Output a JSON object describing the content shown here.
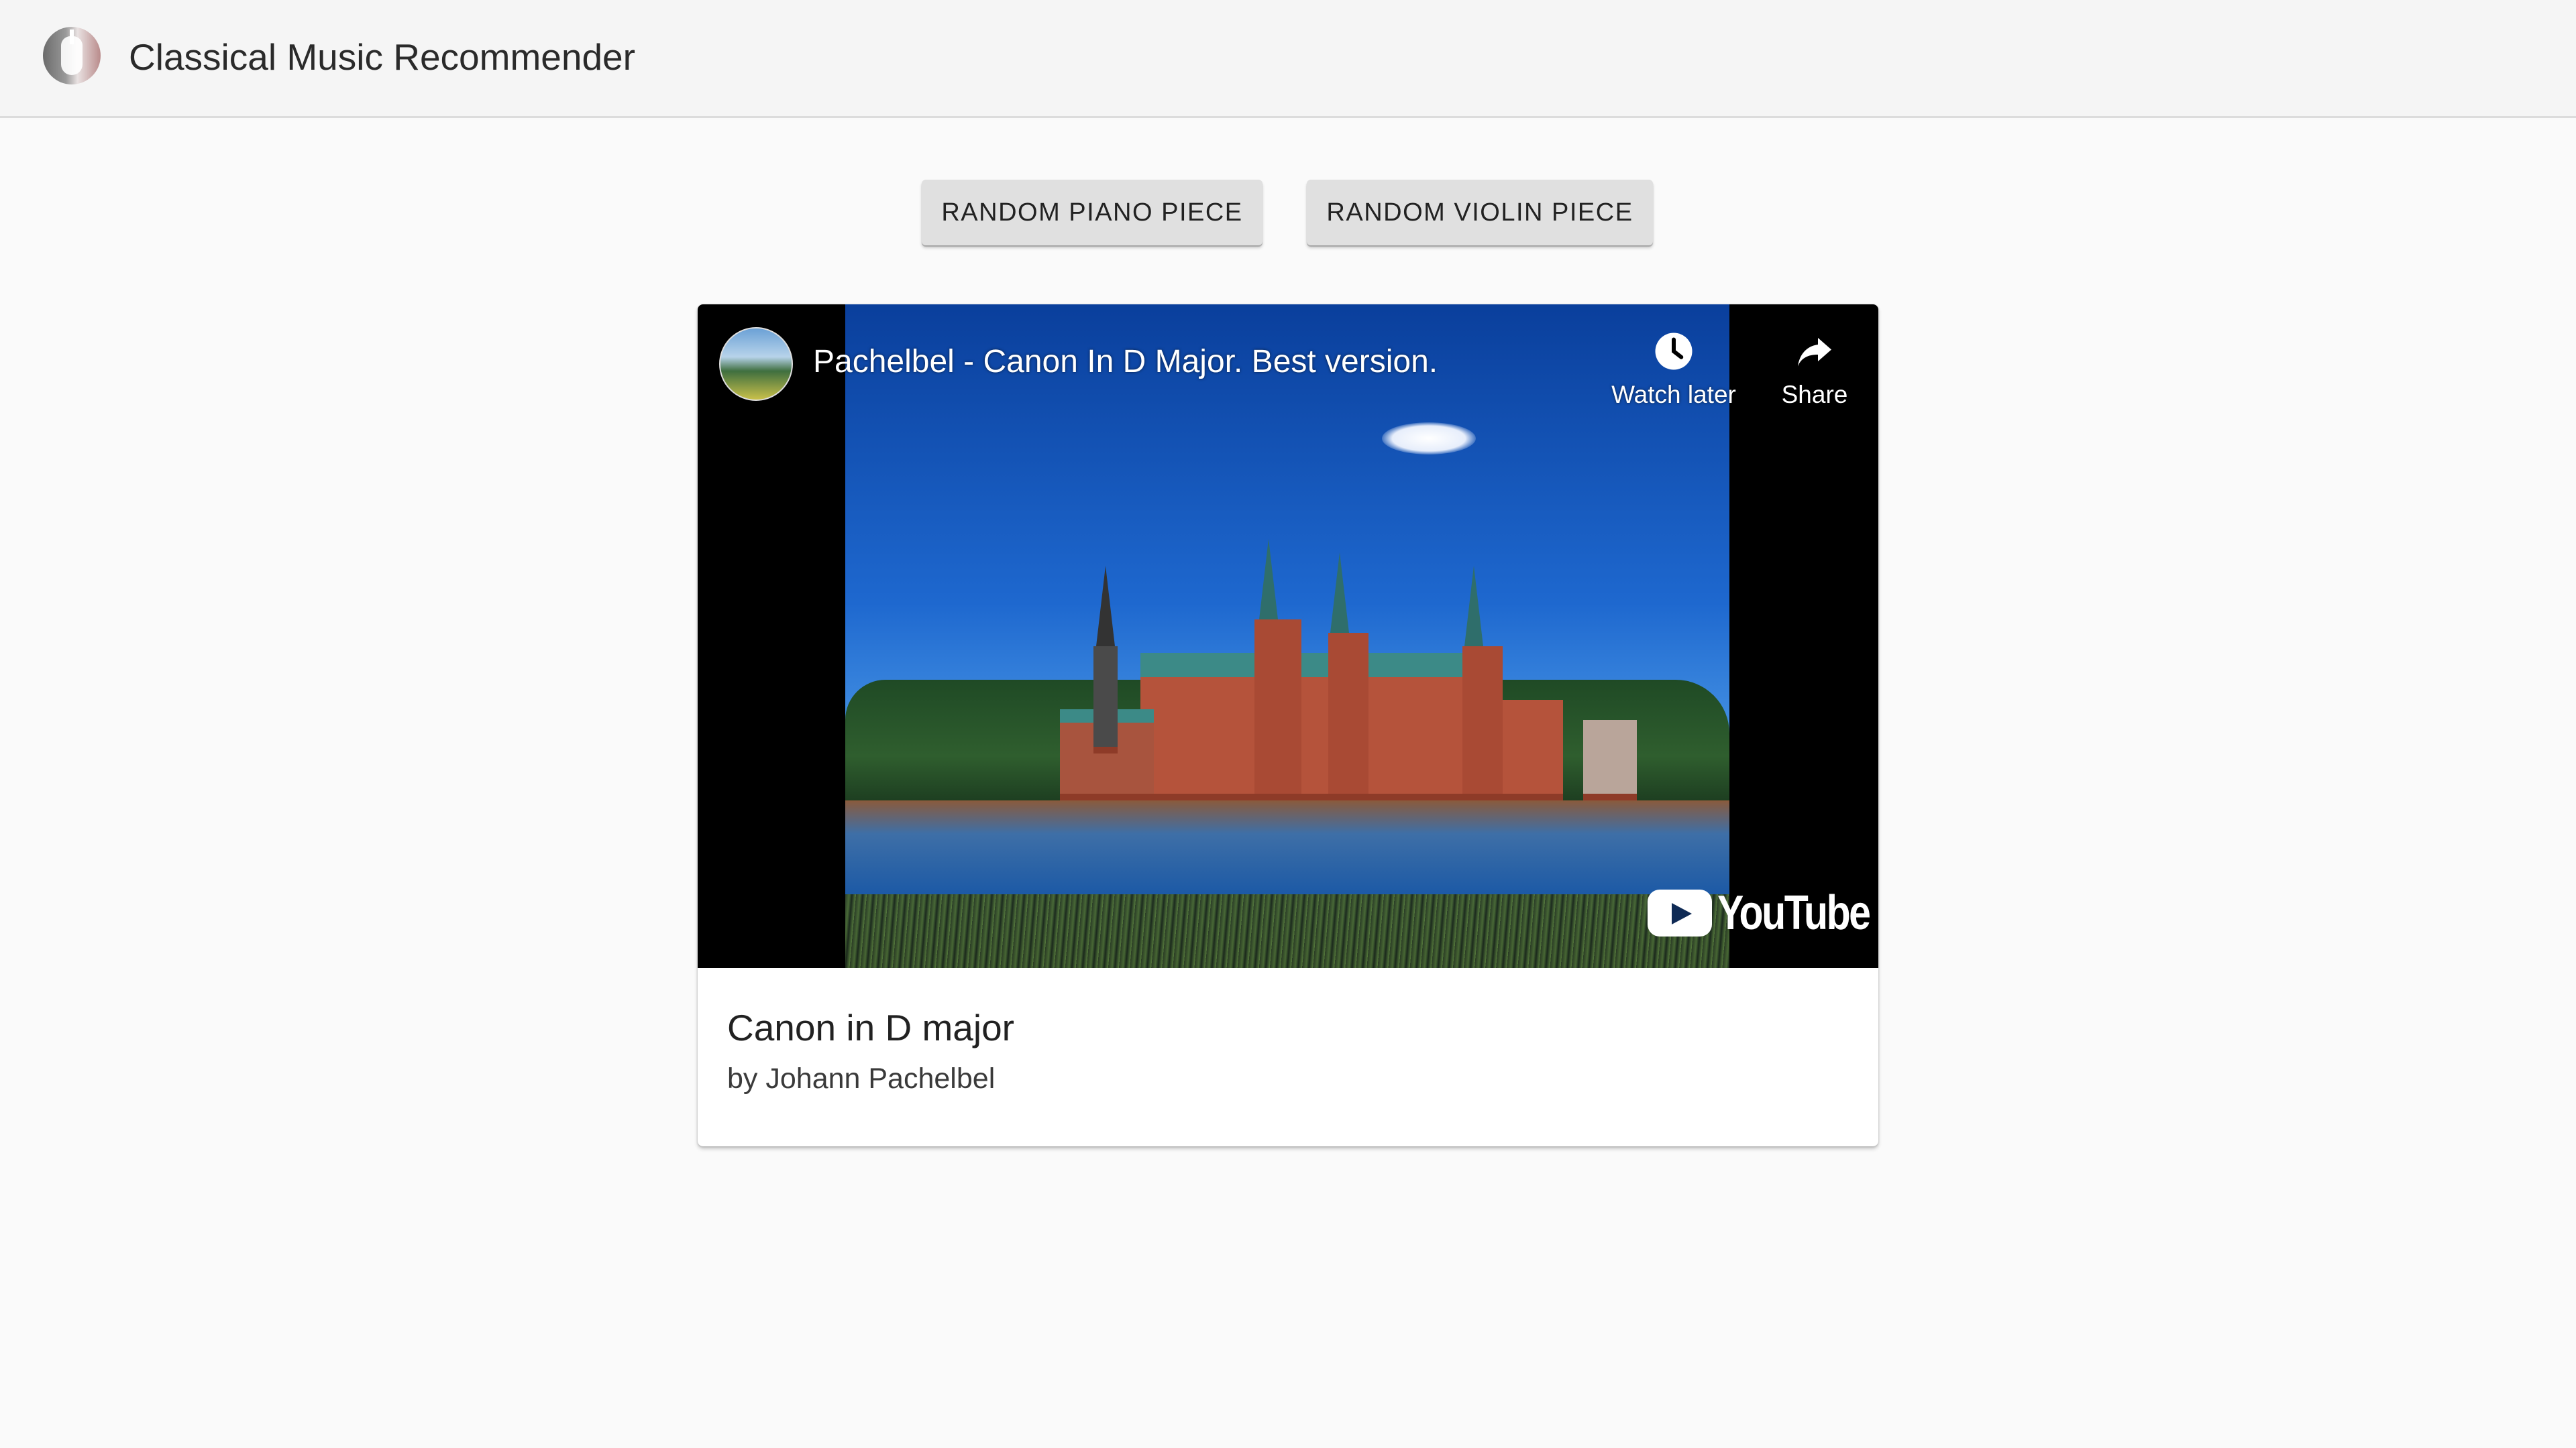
{
  "appbar": {
    "title": "Classical Music Recommender",
    "logo_icon": "violin-logo-icon"
  },
  "actions": {
    "piano_label": "RANDOM PIANO PIECE",
    "violin_label": "RANDOM VIOLIN PIECE"
  },
  "player": {
    "video_title": "Pachelbel - Canon In D Major. Best version.",
    "watch_later_label": "Watch later",
    "share_label": "Share",
    "brand_text": "YouTube",
    "watch_later_icon": "clock-icon",
    "share_icon": "share-arrow-icon"
  },
  "piece": {
    "title": "Canon in D major",
    "composer": "by Johann Pachelbel"
  },
  "colors": {
    "appbar_bg": "#f5f5f5",
    "page_bg": "#fafafa",
    "button_bg": "#e0e0e0",
    "player_bg": "#000000"
  }
}
